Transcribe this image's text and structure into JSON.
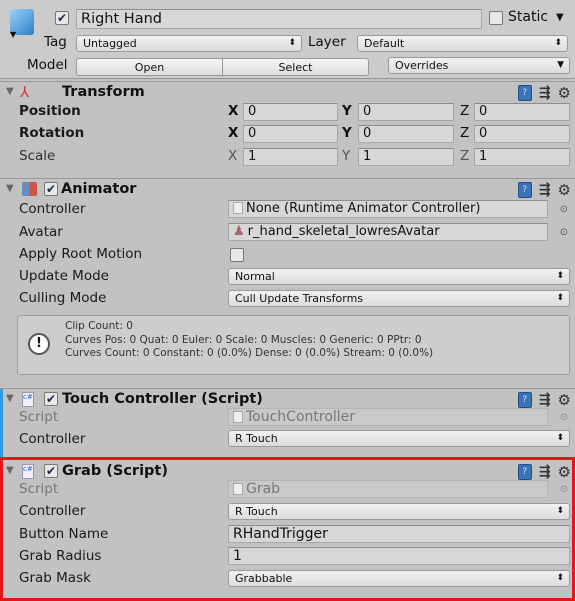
{
  "object": {
    "name": "Right Hand",
    "active": true,
    "static_label": "Static",
    "static": false,
    "tag_label": "Tag",
    "tag": "Untagged",
    "layer_label": "Layer",
    "layer": "Default",
    "model_label": "Model",
    "open_label": "Open",
    "select_label": "Select",
    "overrides_label": "Overrides"
  },
  "transform": {
    "title": "Transform",
    "rows": [
      {
        "label": "Position",
        "x": "0",
        "y": "0",
        "z": "0"
      },
      {
        "label": "Rotation",
        "x": "0",
        "y": "0",
        "z": "0"
      },
      {
        "label": "Scale",
        "x": "1",
        "y": "1",
        "z": "1"
      }
    ],
    "axes": {
      "x": "X",
      "y": "Y",
      "z": "Z"
    }
  },
  "animator": {
    "title": "Animator",
    "enabled": true,
    "controller_label": "Controller",
    "controller": "None (Runtime Animator Controller)",
    "avatar_label": "Avatar",
    "avatar": "r_hand_skeletal_lowresAvatar",
    "apply_root_motion_label": "Apply Root Motion",
    "apply_root_motion": false,
    "update_mode_label": "Update Mode",
    "update_mode": "Normal",
    "culling_mode_label": "Culling Mode",
    "culling_mode": "Cull Update Transforms",
    "info": [
      "Clip Count: 0",
      "Curves Pos: 0 Quat: 0 Euler: 0 Scale: 0 Muscles: 0 Generic: 0 PPtr: 0",
      "Curves Count: 0 Constant: 0 (0.0%) Dense: 0 (0.0%) Stream: 0 (0.0%)"
    ]
  },
  "touch_controller": {
    "title": "Touch Controller (Script)",
    "enabled": true,
    "script_label": "Script",
    "script": "TouchController",
    "controller_label": "Controller",
    "controller": "R Touch"
  },
  "grab": {
    "title": "Grab (Script)",
    "enabled": true,
    "script_label": "Script",
    "script": "Grab",
    "controller_label": "Controller",
    "controller": "R Touch",
    "button_name_label": "Button Name",
    "button_name": "RHandTrigger",
    "grab_radius_label": "Grab Radius",
    "grab_radius": "1",
    "grab_mask_label": "Grab Mask",
    "grab_mask": "Grabbable",
    "highlight_color": "#e8141c"
  },
  "colors": {
    "panel": "#c2c2c2",
    "header_area": "#cbcbcb",
    "selected_stripe": "#2f9ae6"
  }
}
